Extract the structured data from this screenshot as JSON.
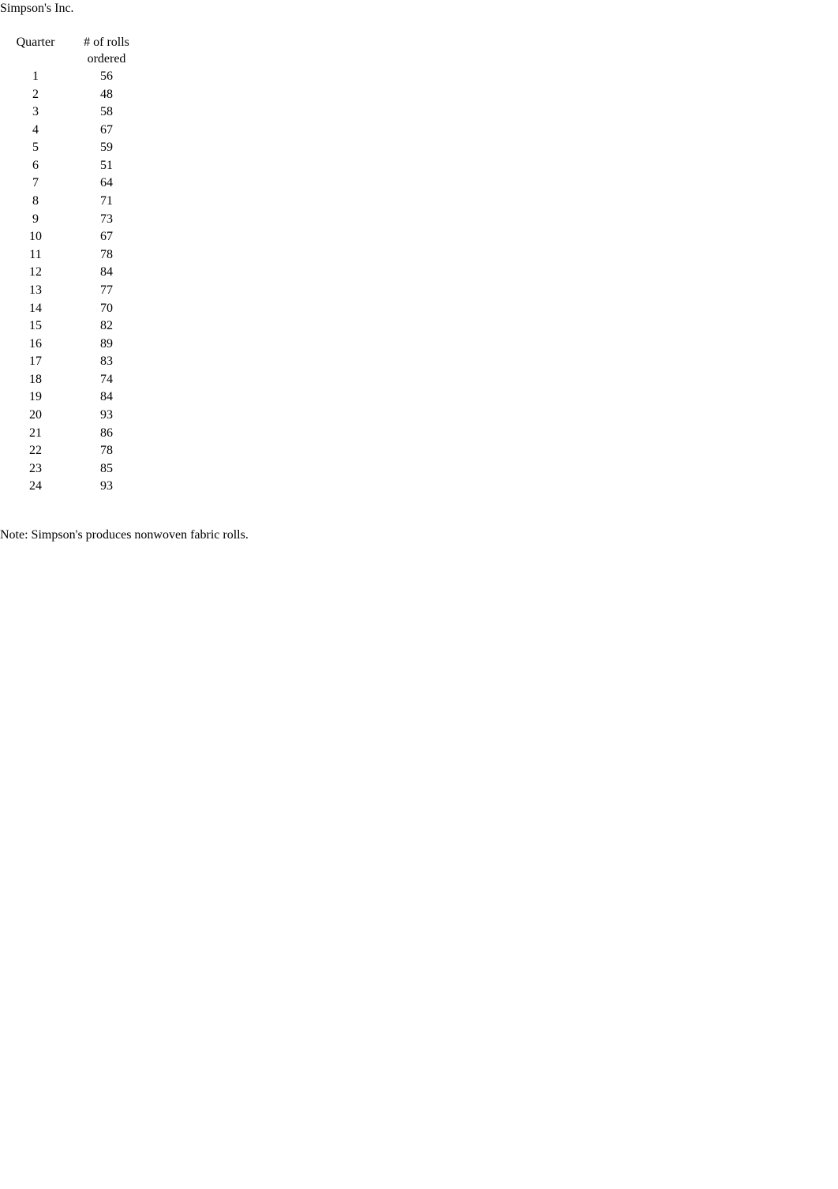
{
  "document": {
    "title": "Simpson's Inc.",
    "note": "Note: Simpson's produces nonwoven fabric rolls."
  },
  "table": {
    "headers": {
      "quarter": "Quarter",
      "rolls_line1": "# of rolls",
      "rolls_line2": "ordered"
    },
    "rows": [
      {
        "quarter": "1",
        "rolls": "56"
      },
      {
        "quarter": "2",
        "rolls": "48"
      },
      {
        "quarter": "3",
        "rolls": "58"
      },
      {
        "quarter": "4",
        "rolls": "67"
      },
      {
        "quarter": "5",
        "rolls": "59"
      },
      {
        "quarter": "6",
        "rolls": "51"
      },
      {
        "quarter": "7",
        "rolls": "64"
      },
      {
        "quarter": "8",
        "rolls": "71"
      },
      {
        "quarter": "9",
        "rolls": "73"
      },
      {
        "quarter": "10",
        "rolls": "67"
      },
      {
        "quarter": "11",
        "rolls": "78"
      },
      {
        "quarter": "12",
        "rolls": "84"
      },
      {
        "quarter": "13",
        "rolls": "77"
      },
      {
        "quarter": "14",
        "rolls": "70"
      },
      {
        "quarter": "15",
        "rolls": "82"
      },
      {
        "quarter": "16",
        "rolls": "89"
      },
      {
        "quarter": "17",
        "rolls": "83"
      },
      {
        "quarter": "18",
        "rolls": "74"
      },
      {
        "quarter": "19",
        "rolls": "84"
      },
      {
        "quarter": "20",
        "rolls": "93"
      },
      {
        "quarter": "21",
        "rolls": "86"
      },
      {
        "quarter": "22",
        "rolls": "78"
      },
      {
        "quarter": "23",
        "rolls": "85"
      },
      {
        "quarter": "24",
        "rolls": "93"
      }
    ]
  },
  "colors": {
    "text": "#000000",
    "background": "#ffffff"
  }
}
